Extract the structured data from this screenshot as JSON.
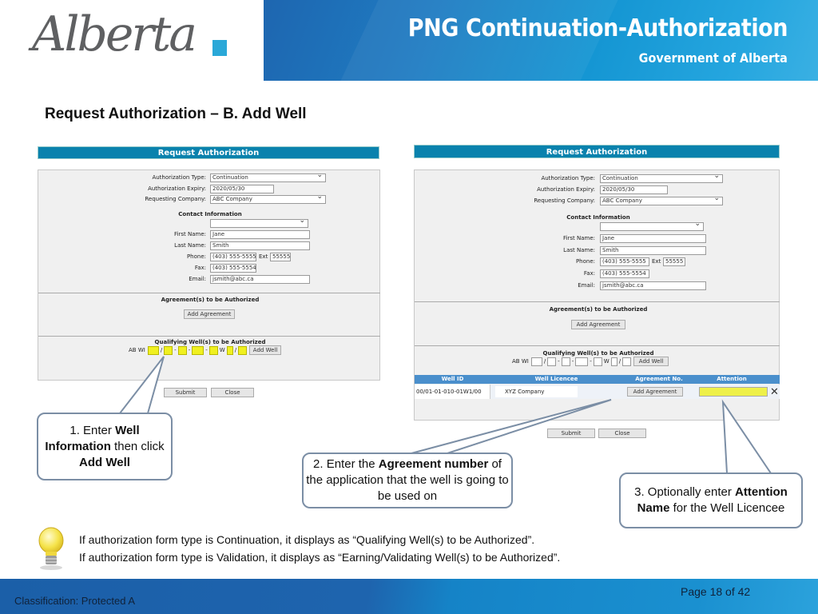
{
  "header": {
    "logo": "Alberta",
    "title": "PNG Continuation-Authorization",
    "subtitle": "Government of Alberta"
  },
  "slide_heading": "Request Authorization – B. Add Well",
  "form_left": {
    "title": "Request Authorization",
    "fields": {
      "auth_type_label": "Authorization Type:",
      "auth_type_value": "Continuation",
      "auth_expiry_label": "Authorization Expiry:",
      "auth_expiry_value": "2020/05/30",
      "company_label": "Requesting Company:",
      "company_value": "ABC Company",
      "contact_title": "Contact Information",
      "contact_select_value": "",
      "first_name_label": "First Name:",
      "first_name_value": "Jane",
      "last_name_label": "Last Name:",
      "last_name_value": "Smith",
      "phone_label": "Phone:",
      "phone_value": "(403) 555-5555",
      "ext_label": "Ext",
      "ext_value": "55555",
      "fax_label": "Fax:",
      "fax_value": "(403) 555-5554",
      "email_label": "Email:",
      "email_value": "jsmith@abc.ca"
    },
    "agreements_title": "Agreement(s) to be Authorized",
    "add_agreement_label": "Add Agreement",
    "wells_title": "Qualifying Well(s) to be Authorized",
    "well_prefix": "AB WI",
    "well_separators": [
      "/",
      "-",
      "-",
      "-",
      "W",
      "/"
    ],
    "add_well_label": "Add Well",
    "submit_label": "Submit",
    "close_label": "Close"
  },
  "form_right": {
    "title": "Request Authorization",
    "fields": {
      "auth_type_label": "Authorization Type:",
      "auth_type_value": "Continuation",
      "auth_expiry_label": "Authorization Expiry:",
      "auth_expiry_value": "2020/05/30",
      "company_label": "Requesting Company:",
      "company_value": "ABC Company",
      "contact_title": "Contact Information",
      "contact_select_value": "",
      "first_name_label": "First Name:",
      "first_name_value": "Jane",
      "last_name_label": "Last Name:",
      "last_name_value": "Smith",
      "phone_label": "Phone:",
      "phone_value": "(403) 555-5555",
      "ext_label": "Ext",
      "ext_value": "55555",
      "fax_label": "Fax:",
      "fax_value": "(403) 555-5554",
      "email_label": "Email:",
      "email_value": "jsmith@abc.ca"
    },
    "agreements_title": "Agreement(s) to be Authorized",
    "add_agreement_label": "Add Agreement",
    "wells_title": "Qualifying Well(s) to be Authorized",
    "well_prefix": "AB WI",
    "well_separators": [
      "/",
      "-",
      "-",
      "-",
      "W",
      "/"
    ],
    "add_well_label": "Add Well",
    "table": {
      "headers": [
        "Well ID",
        "Well Licencee",
        "Agreement No.",
        "Attention"
      ],
      "rows": [
        {
          "well_id": "00/01-01-010-01W1/00",
          "licencee": "XYZ Company",
          "agreement_button": "Add Agreement",
          "attention": ""
        }
      ]
    },
    "submit_label": "Submit",
    "close_label": "Close"
  },
  "callouts": {
    "c1": {
      "num": "1. Enter ",
      "b1": "Well Information",
      "t1": " then click ",
      "b2": "Add Well"
    },
    "c2": {
      "num": "2. Enter the ",
      "b1": "Agreement number",
      "t1": " of the application that the well is going to be used on"
    },
    "c3": {
      "num": "3. Optionally enter ",
      "b1": "Attention Name",
      "t1": " for the Well Licencee"
    }
  },
  "tips": [
    "If authorization form type is Continuation, it displays as “Qualifying Well(s) to be Authorized”.",
    "If authorization form type is Validation, it displays as “Earning/Validating Well(s) to be Authorized”."
  ],
  "footer": {
    "classification": "Classification: Protected A",
    "page": "Page 18 of 42"
  }
}
